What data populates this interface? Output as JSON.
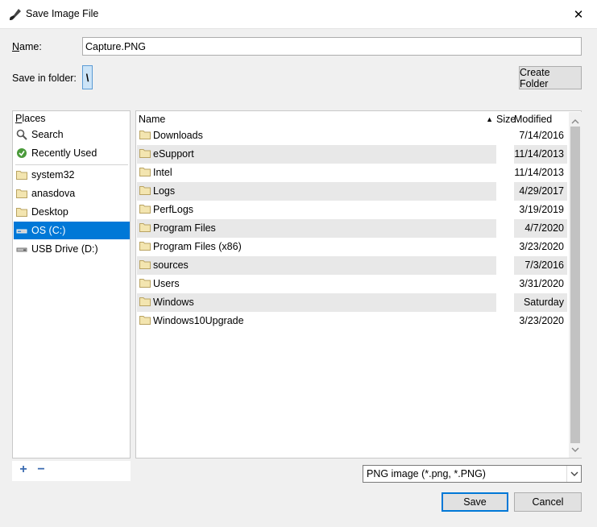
{
  "window": {
    "title": "Save Image File",
    "close_glyph": "✕"
  },
  "name_row": {
    "label": "Name:",
    "value": "Capture.PNG"
  },
  "folder_row": {
    "label": "Save in folder:",
    "path_segment": "\\",
    "create_folder_label": "Create Folder"
  },
  "places": {
    "header": "Places",
    "items": [
      {
        "label": "Search",
        "icon": "search-icon"
      },
      {
        "label": "Recently Used",
        "icon": "recent-icon"
      },
      {
        "label": "system32",
        "icon": "folder-icon"
      },
      {
        "label": "anasdova",
        "icon": "folder-icon"
      },
      {
        "label": "Desktop",
        "icon": "folder-icon"
      },
      {
        "label": "OS (C:)",
        "icon": "drive-icon",
        "selected": true
      },
      {
        "label": "USB Drive (D:)",
        "icon": "usb-drive-icon"
      }
    ],
    "add_glyph": "+",
    "remove_glyph": "−"
  },
  "files": {
    "columns": {
      "name": "Name",
      "size": "Size",
      "modified": "Modified"
    },
    "sort_glyph": "▲",
    "rows": [
      {
        "name": "Downloads",
        "modified": "7/14/2016"
      },
      {
        "name": "eSupport",
        "modified": "11/14/2013"
      },
      {
        "name": "Intel",
        "modified": "11/14/2013"
      },
      {
        "name": "Logs",
        "modified": "4/29/2017"
      },
      {
        "name": "PerfLogs",
        "modified": "3/19/2019"
      },
      {
        "name": "Program Files",
        "modified": "4/7/2020"
      },
      {
        "name": "Program Files (x86)",
        "modified": "3/23/2020"
      },
      {
        "name": "sources",
        "modified": "7/3/2016"
      },
      {
        "name": "Users",
        "modified": "3/31/2020"
      },
      {
        "name": "Windows",
        "modified": "Saturday"
      },
      {
        "name": "Windows10Upgrade",
        "modified": "3/23/2020"
      }
    ]
  },
  "filter": {
    "selected": "PNG image (*.png, *.PNG)"
  },
  "actions": {
    "save_label": "Save",
    "cancel_label": "Cancel"
  },
  "colors": {
    "accent": "#0078d7",
    "folder": "#dcc98a",
    "stripe": "#e8e8e8"
  }
}
